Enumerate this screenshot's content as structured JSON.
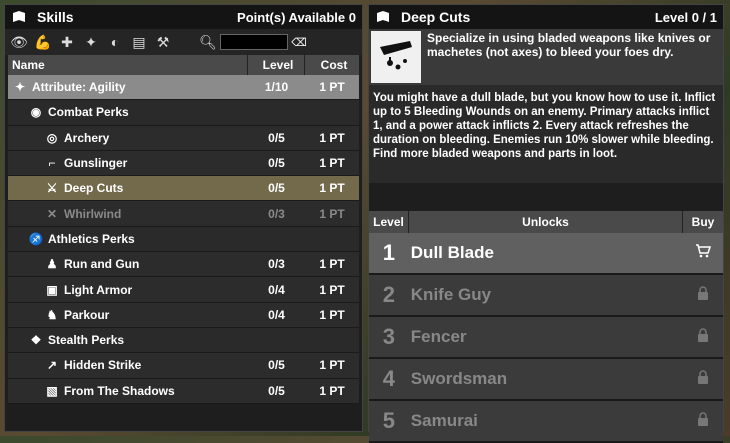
{
  "skills_panel": {
    "title": "Skills",
    "points_label": "Point(s) Available 0",
    "search_value": "",
    "headers": {
      "name": "Name",
      "level": "Level",
      "cost": "Cost"
    },
    "rows": [
      {
        "name": "Attribute: Agility",
        "level": "1/10",
        "cost": "1 PT",
        "icon": "agility-icon",
        "glyph": "✦"
      },
      {
        "name": "Combat Perks",
        "level": "",
        "cost": "",
        "icon": "combat-perks-icon",
        "glyph": "◉"
      },
      {
        "name": "Archery",
        "level": "0/5",
        "cost": "1 PT",
        "icon": "bow-icon",
        "glyph": "◎"
      },
      {
        "name": "Gunslinger",
        "level": "0/5",
        "cost": "1 PT",
        "icon": "pistol-icon",
        "glyph": "⌐"
      },
      {
        "name": "Deep Cuts",
        "level": "0/5",
        "cost": "1 PT",
        "icon": "blade-icon",
        "glyph": "⚔"
      },
      {
        "name": "Whirlwind",
        "level": "0/3",
        "cost": "1 PT",
        "icon": "crossed-blades-icon",
        "glyph": "✕"
      },
      {
        "name": "Athletics Perks",
        "level": "",
        "cost": "",
        "icon": "runner-icon",
        "glyph": "♐"
      },
      {
        "name": "Run and Gun",
        "level": "0/3",
        "cost": "1 PT",
        "icon": "run-gun-icon",
        "glyph": "♟"
      },
      {
        "name": "Light Armor",
        "level": "0/4",
        "cost": "1 PT",
        "icon": "armor-icon",
        "glyph": "▣"
      },
      {
        "name": "Parkour",
        "level": "0/4",
        "cost": "1 PT",
        "icon": "parkour-icon",
        "glyph": "♞"
      },
      {
        "name": "Stealth Perks",
        "level": "",
        "cost": "",
        "icon": "stealth-icon",
        "glyph": "❖"
      },
      {
        "name": "Hidden Strike",
        "level": "0/5",
        "cost": "1 PT",
        "icon": "hidden-strike-icon",
        "glyph": "↗"
      },
      {
        "name": "From The Shadows",
        "level": "0/5",
        "cost": "1 PT",
        "icon": "shadows-icon",
        "glyph": "▧"
      }
    ]
  },
  "detail_panel": {
    "title": "Deep Cuts",
    "level_label": "Level 0 / 1",
    "short_desc": "Specialize in using bladed weapons like knives or machetes (not axes) to bleed your foes dry.",
    "long_desc": "You might have a dull blade, but you know how to use it. Inflict up to 5 Bleeding Wounds on an enemy. Primary attacks inflict 1, and a power attack inflicts 2. Every attack refreshes the duration on bleeding. Enemies run 10% slower while bleeding. Find more bladed weapons and parts in loot.",
    "headers": {
      "level": "Level",
      "unlocks": "Unlocks",
      "buy": "Buy"
    },
    "unlocks": [
      {
        "level": "1",
        "name": "Dull Blade"
      },
      {
        "level": "2",
        "name": "Knife Guy"
      },
      {
        "level": "3",
        "name": "Fencer"
      },
      {
        "level": "4",
        "name": "Swordsman"
      },
      {
        "level": "5",
        "name": "Samurai"
      }
    ]
  }
}
